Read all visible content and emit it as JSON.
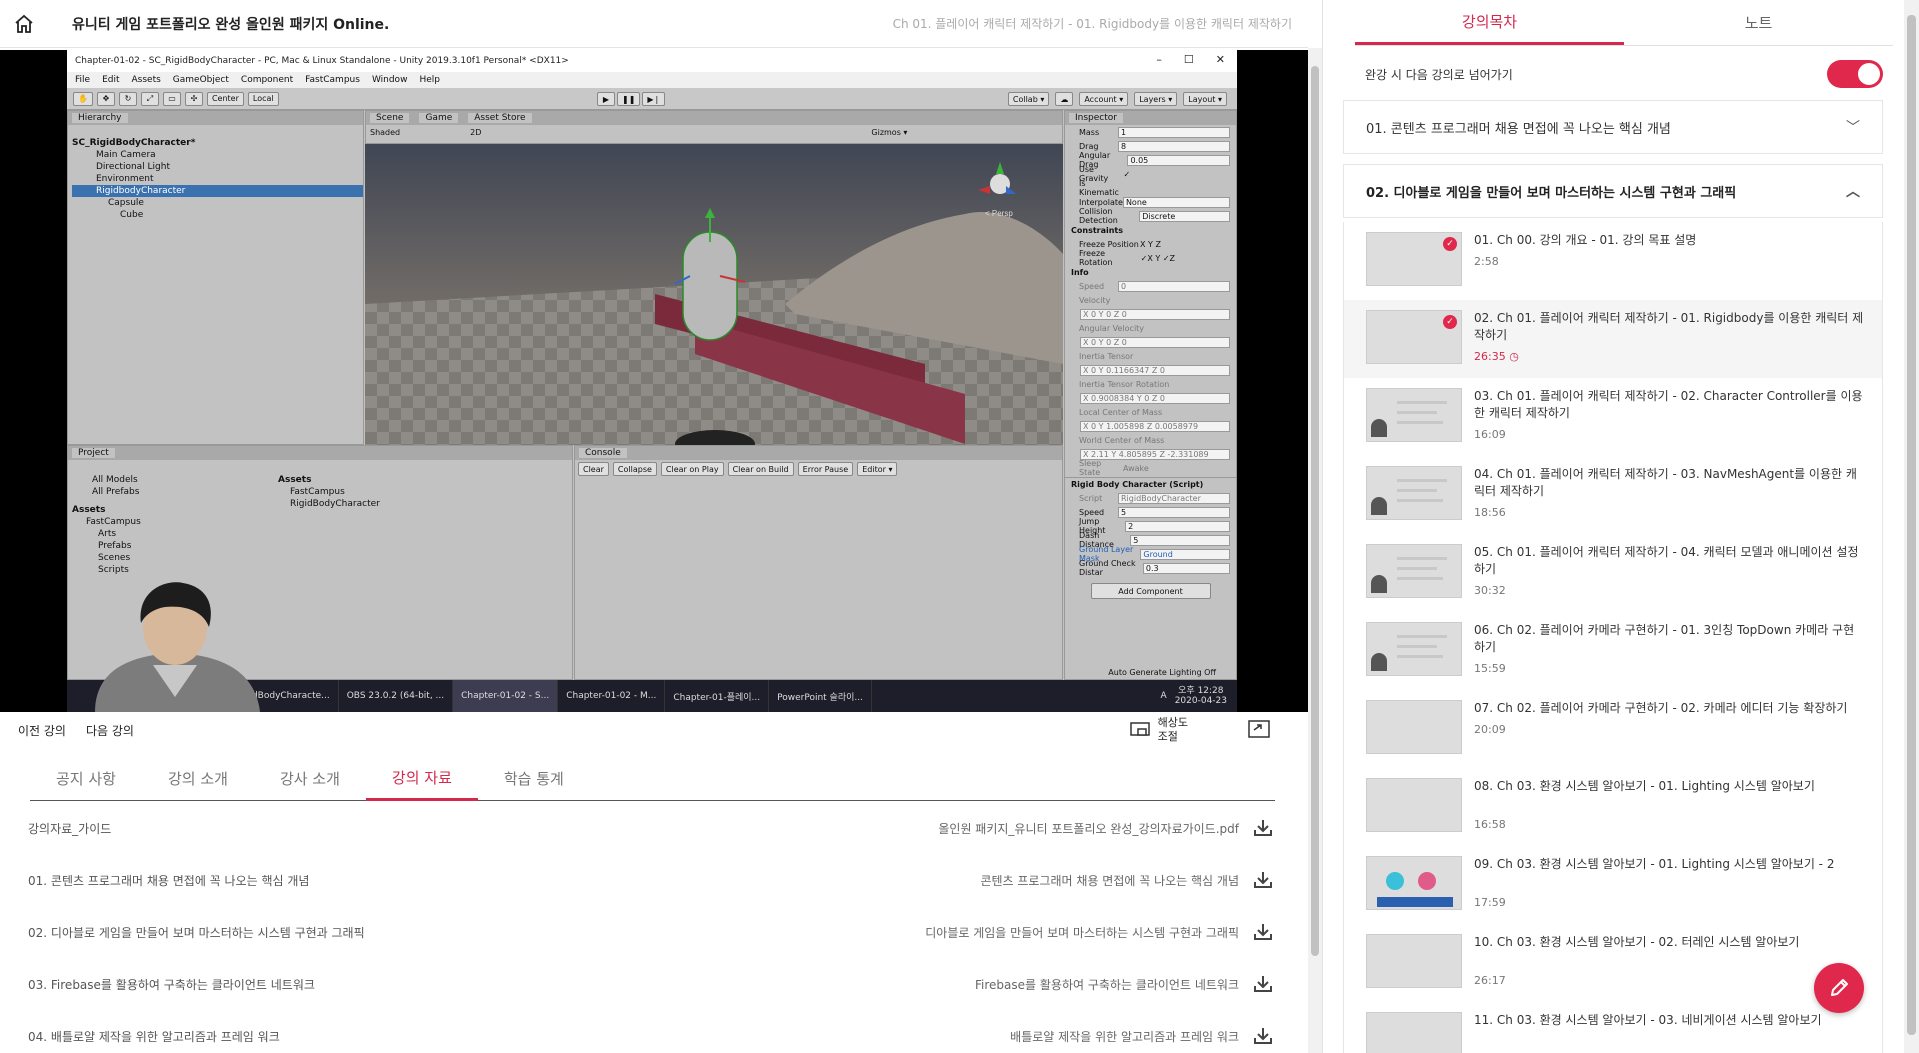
{
  "header": {
    "course_title": "유니티 게임 포트폴리오 완성 올인원 패키지 Online.",
    "current_lecture": "Ch 01. 플레이어 캐릭터 제작하기 - 01. Rigidbody를 이용한 캐릭터 제작하기"
  },
  "video": {
    "window_title": "Chapter-01-02 - SC_RigidBodyCharacter - PC, Mac & Linux Standalone - Unity 2019.3.10f1 Personal* <DX11>",
    "menu": [
      "File",
      "Edit",
      "Assets",
      "GameObject",
      "Component",
      "FastCampus",
      "Window",
      "Help"
    ],
    "toolbar": {
      "center": "Center",
      "local": "Local",
      "collab": "Collab ▾",
      "account": "Account ▾",
      "layers": "Layers ▾",
      "layout": "Layout ▾"
    },
    "hierarchy": {
      "tab": "Hierarchy",
      "items": [
        "SC_RigidBodyCharacter*",
        "Main Camera",
        "Directional Light",
        "Environment",
        "RigidbodyCharacter",
        "Capsule",
        "Cube"
      ]
    },
    "scene": {
      "tabs": [
        "Scene",
        "Game",
        "Asset Store"
      ],
      "shading": "Shaded",
      "mode_2d": "2D",
      "gizmos": "Gizmos ▾",
      "persp": "< Persp"
    },
    "project": {
      "tab": "Project",
      "favorites": [
        "All Models",
        "All Prefabs"
      ],
      "tree": [
        "Assets",
        "FastCampus",
        "Arts",
        "Prefabs",
        "Scenes",
        "Scripts"
      ],
      "assets_header": "Assets",
      "assets": [
        "FastCampus",
        "RigidBodyCharacter"
      ]
    },
    "console": {
      "tab": "Console",
      "buttons": [
        "Clear",
        "Collapse",
        "Clear on Play",
        "Clear on Build",
        "Error Pause",
        "Editor ▾"
      ]
    },
    "inspector": {
      "tab": "Inspector",
      "rows": [
        {
          "label": "Mass",
          "value": "1"
        },
        {
          "label": "Drag",
          "value": "8"
        },
        {
          "label": "Angular Drag",
          "value": "0.05"
        },
        {
          "label": "Use Gravity",
          "value": "✓"
        },
        {
          "label": "Is Kinematic",
          "value": ""
        },
        {
          "label": "Interpolate",
          "value": "None"
        },
        {
          "label": "Collision Detection",
          "value": "Discrete"
        }
      ],
      "constraints": "Constraints",
      "freeze_position": "Freeze Position",
      "freeze_position_value": "X  Y  Z",
      "freeze_rotation": "Freeze Rotation",
      "freeze_rotation_value": "✓X  Y ✓Z",
      "info": "Info",
      "info_rows": [
        {
          "label": "Speed",
          "value": "0"
        },
        {
          "label": "Velocity",
          "value": "X 0   Y 0   Z 0"
        },
        {
          "label": "Angular Velocity",
          "value": "X 0   Y 0   Z 0"
        },
        {
          "label": "Inertia Tensor",
          "value": "X 0   Y 0.1166347   Z 0"
        },
        {
          "label": "Inertia Tensor Rotation",
          "value": "X 0.9008384   Y 0   Z 0"
        },
        {
          "label": "Local Center of Mass",
          "value": "X 0   Y 1.005898   Z 0.0058979"
        },
        {
          "label": "World Center of Mass",
          "value": "X 2.11   Y 4.805895   Z -2.331089"
        },
        {
          "label": "Sleep State",
          "value": "Awake"
        }
      ],
      "script_component": "Rigid Body Character (Script)",
      "script_rows": [
        {
          "label": "Script",
          "value": "RigidBodyCharacter"
        },
        {
          "label": "Speed",
          "value": "5"
        },
        {
          "label": "Jump Height",
          "value": "2"
        },
        {
          "label": "Dash Distance",
          "value": "5"
        },
        {
          "label": "Ground Layer Mask",
          "value": "Ground"
        },
        {
          "label": "Ground Check Distar",
          "value": "0.3"
        }
      ],
      "add_component": "Add Component",
      "status": "Auto Generate Lighting Off"
    },
    "taskbar": {
      "tasks": [
        "RigidBodyCharacte...",
        "OBS 23.0.2 (64-bit, ...",
        "Chapter-01-02 - S...",
        "Chapter-01-02 - M...",
        "Chapter-01-플레이...",
        "PowerPoint 슬라이..."
      ],
      "clock_time": "오후 12:28",
      "clock_date": "2020-04-23",
      "ime": "A"
    }
  },
  "video_controls": {
    "prev": "이전 강의",
    "next": "다음 강의",
    "resolution": "해상도\n조절"
  },
  "tabs": [
    "공지 사항",
    "강의 소개",
    "강사 소개",
    "강의 자료",
    "학습 통계"
  ],
  "active_tab": "강의 자료",
  "materials": [
    {
      "name": "강의자료_가이드",
      "file": "올인원 패키지_유니티 포트폴리오 완성_강의자료가이드.pdf"
    },
    {
      "name": "01. 콘텐츠 프로그래머 채용 면접에 꼭 나오는 핵심 개념",
      "file": "콘텐츠 프로그래머 채용 면접에 꼭 나오는 핵심 개념"
    },
    {
      "name": "02. 디아블로 게임을 만들어 보며 마스터하는 시스템 구현과 그래픽",
      "file": "디아블로 게임을 만들어 보며 마스터하는 시스템 구현과 그래픽"
    },
    {
      "name": "03. Firebase를 활용하여 구축하는 클라이언트 네트워크",
      "file": "Firebase를 활용하여 구축하는 클라이언트 네트워크"
    },
    {
      "name": "04. 배틀로얄 제작을 위한 알고리즘과 프레임 워크",
      "file": "배틀로얄 제작을 위한 알고리즘과 프레임 워크"
    }
  ],
  "sidebar": {
    "tabs": [
      "강의목차",
      "노트"
    ],
    "auto_next_label": "완강 시 다음 강의로 넘어가기",
    "auto_next_on": true,
    "sections": [
      {
        "title": "01. 콘텐츠 프로그래머 채용 면접에 꼭 나오는 핵심 개념",
        "expanded": false
      },
      {
        "title": "02. 디아블로 게임을 만들어 보며 마스터하는 시스템 구현과 그래픽",
        "expanded": true
      }
    ],
    "lessons": [
      {
        "title": "01. Ch 00. 강의 개요 - 01. 강의 목표 설명",
        "duration": "2:58",
        "done": true,
        "thumb": "red"
      },
      {
        "title": "02. Ch 01. 플레이어 캐릭터 제작하기 - 01. Rigidbody를 이용한 캐릭터 제작하기",
        "duration": "26:35",
        "done": true,
        "current": true,
        "thumb": "red"
      },
      {
        "title": "03. Ch 01. 플레이어 캐릭터 제작하기 - 02. Character Controller를 이용한 캐릭터 제작하기",
        "duration": "16:09",
        "thumb": "slide"
      },
      {
        "title": "04. Ch 01. 플레이어 캐릭터 제작하기 - 03. NavMeshAgent를 이용한 캐릭터 제작하기",
        "duration": "18:56",
        "thumb": "slide"
      },
      {
        "title": "05. Ch 01. 플레이어 캐릭터 제작하기 - 04. 캐릭터 모델과 애니메이션 설정하기",
        "duration": "30:32",
        "thumb": "slide"
      },
      {
        "title": "06. Ch 02. 플레이어 카메라 구현하기 - 01. 3인칭 TopDown 카메라 구현하기",
        "duration": "15:59",
        "thumb": "slide"
      },
      {
        "title": "07. Ch 02. 플레이어 카메라 구현하기 - 02. 카메라 에디터 기능 확장하기",
        "duration": "20:09",
        "thumb": "unity"
      },
      {
        "title": "08. Ch 03. 환경 시스템 알아보기 - 01. Lighting 시스템 알아보기",
        "duration": "16:58",
        "thumb": "red"
      },
      {
        "title": "09. Ch 03. 환경 시스템 알아보기 - 01. Lighting 시스템 알아보기 - 2",
        "duration": "17:59",
        "thumb": "light"
      },
      {
        "title": "10. Ch 03. 환경 시스템 알아보기 - 02. 터레인 시스템 알아보기",
        "duration": "26:17",
        "thumb": "terrain"
      },
      {
        "title": "11. Ch 03. 환경 시스템 알아보기 - 03. 네비게이션 시스템 알아보기",
        "duration": "",
        "thumb": "unity"
      }
    ]
  },
  "colors": {
    "accent": "#d4284d",
    "toggle": "#e0284c"
  }
}
